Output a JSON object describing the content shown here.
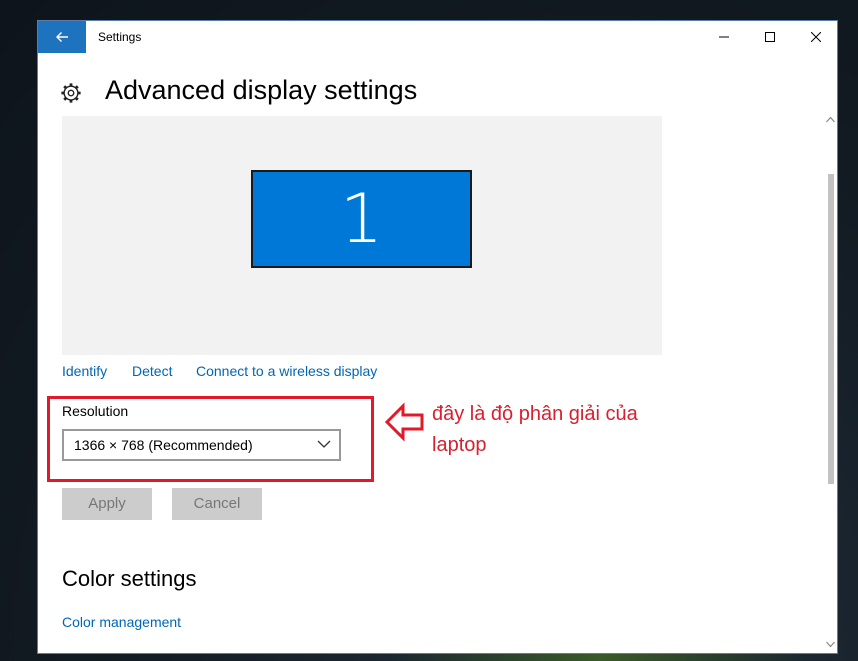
{
  "window": {
    "title": "Settings",
    "controls": {
      "minimize": "minimize",
      "maximize": "maximize",
      "close": "close"
    }
  },
  "page": {
    "title": "Advanced display settings"
  },
  "display": {
    "monitor_label": "1"
  },
  "links": {
    "identify": "Identify",
    "detect": "Detect",
    "wireless": "Connect to a wireless display"
  },
  "resolution": {
    "label": "Resolution",
    "value": "1366 × 768 (Recommended)"
  },
  "annotation": {
    "text": "đây là độ phân giải của laptop",
    "color": "#e1192a"
  },
  "buttons": {
    "apply": "Apply",
    "cancel": "Cancel"
  },
  "color_settings": {
    "title": "Color settings",
    "management_link": "Color management"
  },
  "colors": {
    "accent": "#0078d7",
    "link": "#0066b4",
    "annotation": "#e1192a"
  },
  "icons": [
    "back-arrow-icon",
    "gear-icon",
    "chevron-down-icon",
    "outline-arrow-left-icon"
  ]
}
